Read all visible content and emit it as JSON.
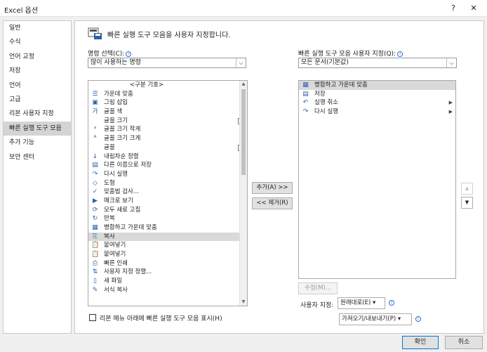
{
  "window": {
    "title": "Excel 옵션",
    "help_label": "?",
    "close_label": "✕"
  },
  "nav": {
    "items": [
      {
        "label": "일반"
      },
      {
        "label": "수식"
      },
      {
        "label": "언어 교정"
      },
      {
        "label": "저장"
      },
      {
        "label": "언어"
      },
      {
        "label": "고급"
      },
      {
        "label": "리본 사용자 지정"
      },
      {
        "label": "빠른 실행 도구 모음",
        "selected": true
      },
      {
        "label": "추가 기능"
      },
      {
        "label": "보안 센터"
      }
    ]
  },
  "heading": "빠른 실행 도구 모음을 사용자 지정합니다.",
  "left": {
    "label": "명령 선택(C):",
    "combo_value": "많이 사용하는 명령",
    "items": [
      {
        "label": "<구분 기호>",
        "icon": "",
        "separator": true
      },
      {
        "label": "가운데 맞춤",
        "icon": "☰"
      },
      {
        "label": "그림 삽입",
        "icon": "▣"
      },
      {
        "label": "글꼴 색",
        "icon": "가",
        "submenu": "▶"
      },
      {
        "label": "글꼴 크기",
        "icon": "",
        "box": "I▾"
      },
      {
        "label": "글꼴 크기 작게",
        "icon": "ᵃ"
      },
      {
        "label": "글꼴 크기 크게",
        "icon": "ᴬ"
      },
      {
        "label": "글꼴",
        "icon": "",
        "box": "I▾"
      },
      {
        "label": "내림차순 정렬",
        "icon": "↓"
      },
      {
        "label": "다른 이름으로 저장",
        "icon": "▤"
      },
      {
        "label": "다시 실행",
        "icon": "↷",
        "submenu": "▶"
      },
      {
        "label": "도형",
        "icon": "◇",
        "submenu": "▶"
      },
      {
        "label": "맞춤법 검사...",
        "icon": "✓"
      },
      {
        "label": "매크로 보기",
        "icon": "▶"
      },
      {
        "label": "모두 새로 고침",
        "icon": "⟳"
      },
      {
        "label": "반복",
        "icon": "↻"
      },
      {
        "label": "병합하고 가운데 맞춤",
        "icon": "▦"
      },
      {
        "label": "복사",
        "icon": "⎘",
        "selected": true
      },
      {
        "label": "붙여넣기",
        "icon": "📋"
      },
      {
        "label": "붙여넣기",
        "icon": "📋",
        "submenu": "▶"
      },
      {
        "label": "빠른 인쇄",
        "icon": "⎙"
      },
      {
        "label": "사용자 지정 정렬...",
        "icon": "⇅"
      },
      {
        "label": "새 파일",
        "icon": "▯"
      },
      {
        "label": "서식 복사",
        "icon": "✎"
      }
    ]
  },
  "right": {
    "label": "빠른 실행 도구 모음 사용자 지정(Q):",
    "combo_value": "모든 문서(기본값)",
    "items": [
      {
        "label": "병합하고 가운데 맞춤",
        "icon": "▦",
        "selected": true
      },
      {
        "label": "저장",
        "icon": "▤"
      },
      {
        "label": "실행 취소",
        "icon": "↶",
        "submenu": "▶"
      },
      {
        "label": "다시 실행",
        "icon": "↷",
        "submenu": "▶"
      }
    ]
  },
  "buttons": {
    "add": "추가(A) >>",
    "remove": "<< 제거(R)",
    "modify": "수정(M)...",
    "up": "▲",
    "down": "▼"
  },
  "customizations": {
    "label": "사용자 지정:",
    "reset": "원래대로(E)",
    "import_export": "가져오기/내보내기(P)"
  },
  "show_below_ribbon": "리본 메뉴 아래에 빠른 실행 도구 모음 표시(H)",
  "footer": {
    "ok": "확인",
    "cancel": "취소"
  },
  "colors": {
    "accent": "#0078d7",
    "selection": "#d9d9d9",
    "icon": "#2d5fa8"
  }
}
